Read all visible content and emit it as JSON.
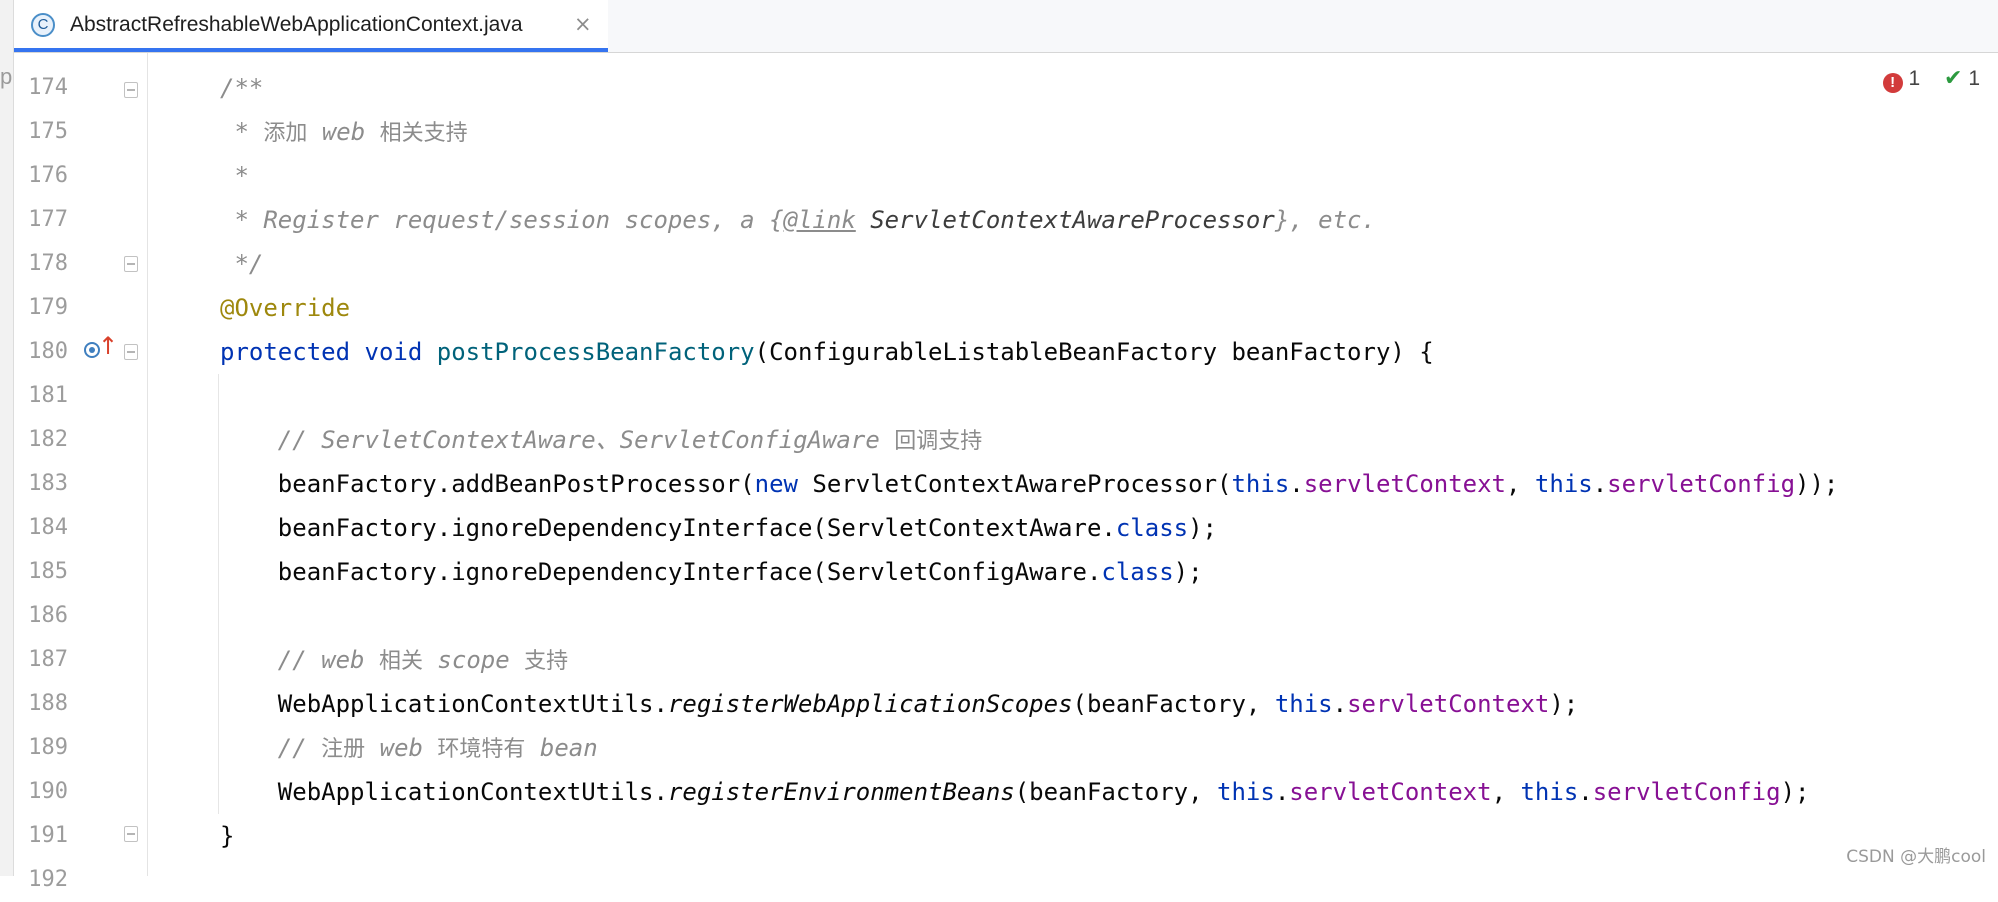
{
  "tab": {
    "icon_letter": "C",
    "filename": "AbstractRefreshableWebApplicationContext.java",
    "close_glyph": "×"
  },
  "left_strip_glyph": "p",
  "inspections": {
    "errors": "1",
    "ok": "1",
    "error_glyph": "!",
    "ok_glyph": "✔"
  },
  "line_numbers": [
    "174",
    "175",
    "176",
    "177",
    "178",
    "179",
    "180",
    "181",
    "182",
    "183",
    "184",
    "185",
    "186",
    "187",
    "188",
    "189",
    "190",
    "191",
    "192"
  ],
  "code": {
    "l174": {
      "open": "/**"
    },
    "l175": {
      "star": " * ",
      "cjk1": "添加",
      "sp1": " web ",
      "cjk2": "相关支持"
    },
    "l176": {
      "star": " *"
    },
    "l177": {
      "pre": " * Register request/session scopes, a {",
      "tag": "@link",
      "sp": " ",
      "ref": "ServletContextAwareProcessor",
      "post": "}, etc."
    },
    "l178": {
      "close": " */"
    },
    "l179": {
      "annotation": "@Override"
    },
    "l180": {
      "kw1": "protected",
      "sp1": " ",
      "kw2": "void",
      "sp2": " ",
      "fn": "postProcessBeanFactory",
      "rest": "(ConfigurableListableBeanFactory beanFactory) {"
    },
    "l182": {
      "pre": "    // ServletContextAware、ServletConfigAware ",
      "cjk": "回调支持"
    },
    "l183": {
      "a": "    beanFactory.addBeanPostProcessor(",
      "kw_new": "new",
      "b": " ServletContextAwareProcessor(",
      "this1": "this",
      "dot1": ".",
      "f1": "servletContext",
      "c": ", ",
      "this2": "this",
      "dot2": ".",
      "f2": "servletConfig",
      "d": "));"
    },
    "l184": {
      "a": "    beanFactory.ignoreDependencyInterface(ServletContextAware.",
      "kw": "class",
      "b": ");"
    },
    "l185": {
      "a": "    beanFactory.ignoreDependencyInterface(ServletConfigAware.",
      "kw": "class",
      "b": ");"
    },
    "l187": {
      "pre": "    // web ",
      "cjk1": "相关",
      "mid": " scope ",
      "cjk2": "支持"
    },
    "l188": {
      "a": "    WebApplicationContextUtils.",
      "st": "registerWebApplicationScopes",
      "b": "(beanFactory, ",
      "this1": "this",
      "dot1": ".",
      "f1": "servletContext",
      "c": ");"
    },
    "l189": {
      "pre": "    // ",
      "cjk1": "注册",
      "mid": " web ",
      "cjk2": "环境特有",
      "post": " bean"
    },
    "l190": {
      "a": "    WebApplicationContextUtils.",
      "st": "registerEnvironmentBeans",
      "b": "(beanFactory, ",
      "this1": "this",
      "dot1": ".",
      "f1": "servletContext",
      "c": ", ",
      "this2": "this",
      "dot2": ".",
      "f2": "servletConfig",
      "d": ");"
    },
    "l191": {
      "brace": "}"
    }
  },
  "watermark": "CSDN @大鹏cool",
  "colors": {
    "keyword": "#0033b3",
    "method": "#00627a",
    "field": "#871094",
    "annotation": "#9e880d",
    "comment": "#8c8c8c",
    "tab_accent": "#3574f0"
  }
}
